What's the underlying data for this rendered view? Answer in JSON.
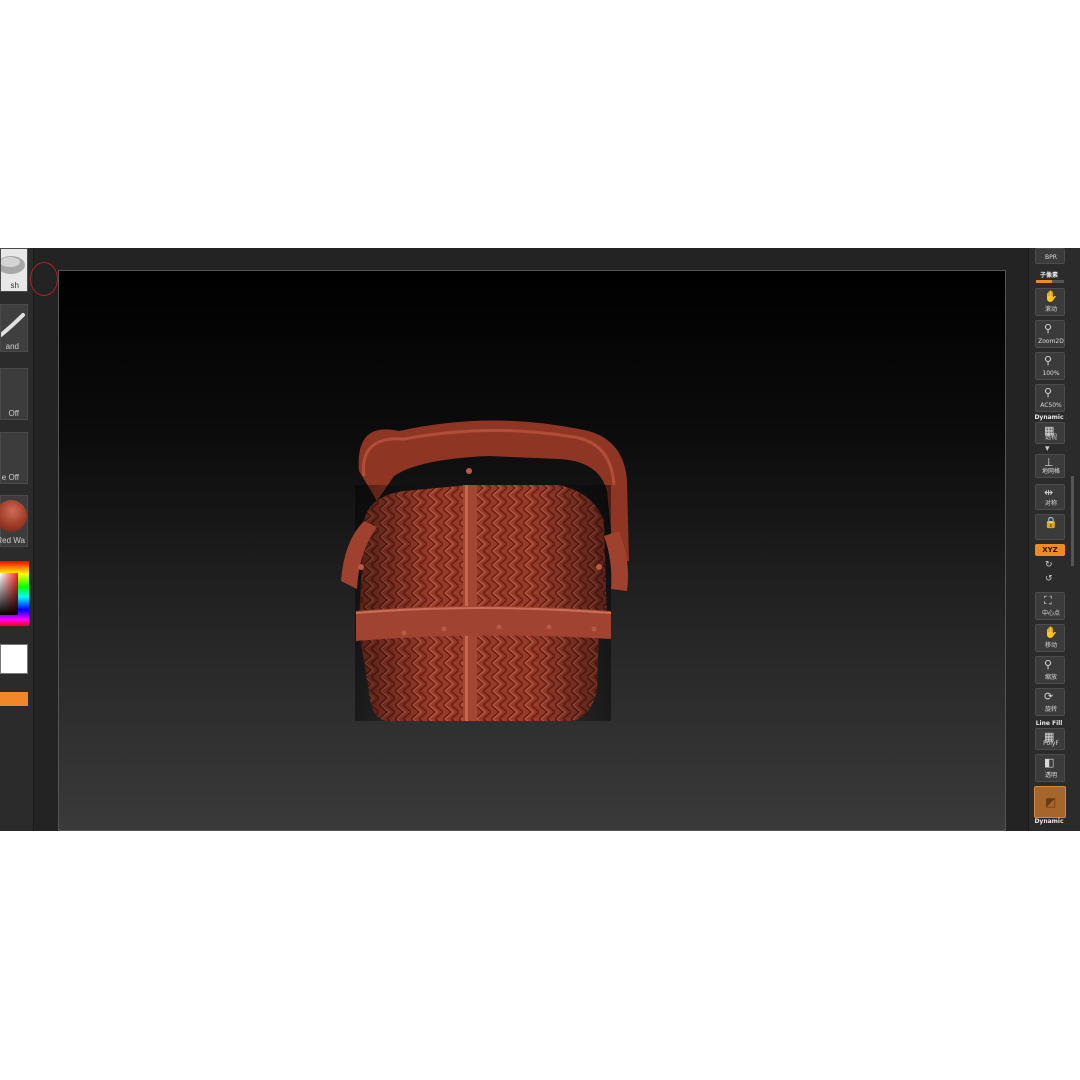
{
  "left_shelf": {
    "brush_label": "sh",
    "stroke_label": "and",
    "alpha_label": "Off",
    "texture_label": "e Off",
    "material_label": "Red Wa"
  },
  "right_shelf": {
    "bpr": "BPR",
    "subpixel": "子像素",
    "scroll": "滚动",
    "zoom2d": "Zoom2D",
    "p100": "100%",
    "ac50": "AC50%",
    "dynamic": "Dynamic",
    "persp": "透视",
    "floor": "地网格",
    "local": "对称",
    "xyz": "XYZ",
    "frame": "中心点",
    "move": "移动",
    "scale": "缩放",
    "rotate": "旋转",
    "linefill": "Line Fill",
    "polyf": "PolyF",
    "transp": "透明",
    "dynamic2": "Dynamic"
  },
  "colors": {
    "accent": "#f08a24",
    "model": "#9c3e2c"
  },
  "viewport": {
    "object": "sculpted-armor-mesh"
  }
}
